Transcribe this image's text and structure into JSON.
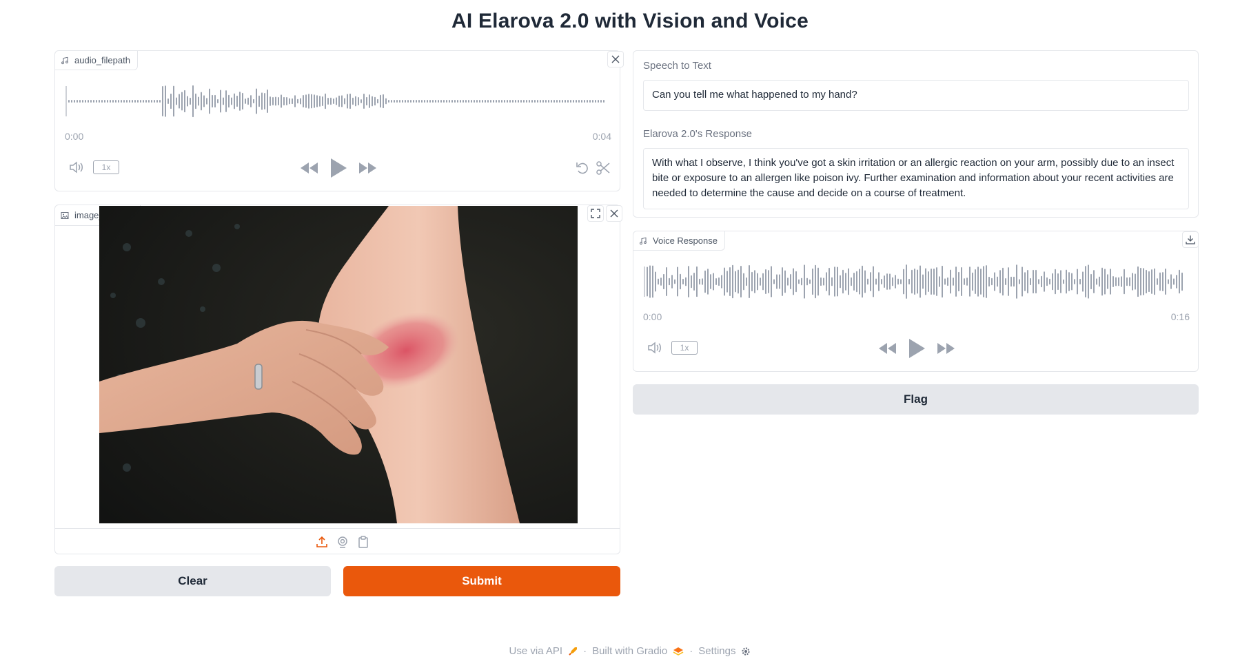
{
  "page": {
    "title": "AI Elarova 2.0 with Vision and Voice"
  },
  "audio_input": {
    "label": "audio_filepath",
    "time_start": "0:00",
    "time_end": "0:04",
    "playback_rate": "1x"
  },
  "image_input": {
    "label": "image_filepath",
    "image_description": "forearm-with-red-rash"
  },
  "buttons": {
    "clear": "Clear",
    "submit": "Submit",
    "flag": "Flag"
  },
  "speech_to_text": {
    "label": "Speech to Text",
    "value": "Can you tell me what happened to my hand?"
  },
  "response": {
    "label": "Elarova 2.0's Response",
    "value": "With what I observe, I think you've got a skin irritation or an allergic reaction on your arm, possibly due to an insect bite or exposure to an allergen like poison ivy. Further examination and information about your recent activities are needed to determine the cause and decide on a course of treatment."
  },
  "voice_response": {
    "label": "Voice Response",
    "time_start": "0:00",
    "time_end": "0:16",
    "playback_rate": "1x"
  },
  "footer": {
    "api": "Use via API",
    "built": "Built with Gradio",
    "settings": "Settings",
    "separator": "·"
  },
  "colors": {
    "accent": "#ea580c",
    "secondary_button": "#e5e7eb",
    "wave": "#9ca3af"
  }
}
